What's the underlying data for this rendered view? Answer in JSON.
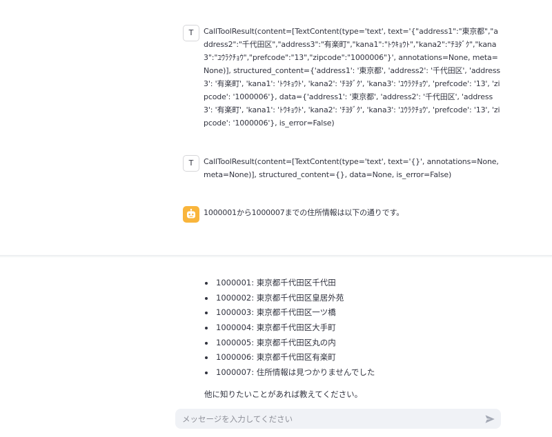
{
  "messages": [
    {
      "role": "tool",
      "avatar_label": "T",
      "text": "CallToolResult(content=[TextContent(type='text', text='{\"address1\":\"東京都\",\"address2\":\"千代田区\",\"address3\":\"有楽町\",\"kana1\":\"ﾄｳｷｮｳﾄ\",\"kana2\":\"ﾁﾖﾀﾞｸ\",\"kana3\":\"ﾕｳﾗｸﾁｮｳ\",\"prefcode\":\"13\",\"zipcode\":\"1000006\"}', annotations=None, meta=None)], structured_content={'address1': '東京都', 'address2': '千代田区', 'address3': '有楽町', 'kana1': 'ﾄｳｷｮｳﾄ', 'kana2': 'ﾁﾖﾀﾞｸ', 'kana3': 'ﾕｳﾗｸﾁｮｳ', 'prefcode': '13', 'zipcode': '1000006'}, data={'address1': '東京都', 'address2': '千代田区', 'address3': '有楽町', 'kana1': 'ﾄｳｷｮｳﾄ', 'kana2': 'ﾁﾖﾀﾞｸ', 'kana3': 'ﾕｳﾗｸﾁｮｳ', 'prefcode': '13', 'zipcode': '1000006'}, is_error=False)"
    },
    {
      "role": "tool",
      "avatar_label": "T",
      "text": "CallToolResult(content=[TextContent(type='text', text='{}', annotations=None, meta=None)], structured_content={}, data=None, is_error=False)"
    },
    {
      "role": "assistant",
      "avatar_icon": "robot-icon",
      "avatar_color": "#f9b53c",
      "text": "1000001から1000007までの住所情報は以下の通りです。"
    }
  ],
  "results": [
    "1000001: 東京都千代田区千代田",
    "1000002: 東京都千代田区皇居外苑",
    "1000003: 東京都千代田区一ツ橋",
    "1000004: 東京都千代田区大手町",
    "1000005: 東京都千代田区丸の内",
    "1000006: 東京都千代田区有楽町",
    "1000007: 住所情報は見つかりませんでした"
  ],
  "closing": "他に知りたいことがあれば教えてください。",
  "chat_input": {
    "placeholder": "メッセージを入力してください",
    "value": "",
    "send_icon": "send-icon"
  }
}
